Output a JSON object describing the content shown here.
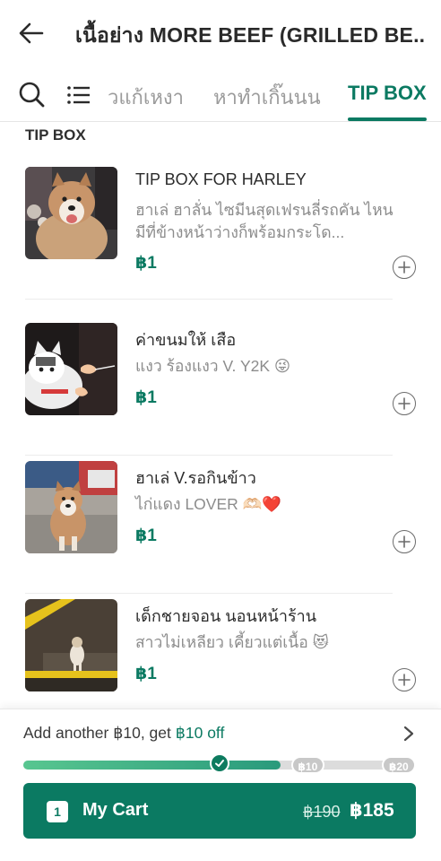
{
  "header": {
    "back_icon": "arrow-left-icon",
    "title": "เนื้อย่าง MORE BEEF (GRILLED BE..."
  },
  "tabbar": {
    "search_icon": "search-icon",
    "menu_icon": "list-menu-icon",
    "tabs": [
      {
        "label": "วแก้เหงา",
        "active": false
      },
      {
        "label": "หาทำเกิ๊นนน",
        "active": false
      },
      {
        "label": "TIP BOX",
        "active": true
      }
    ]
  },
  "section": {
    "title": "TIP BOX"
  },
  "items": [
    {
      "name": "TIP BOX FOR HARLEY",
      "description": "ฮาเล่ ฮาลั่น ไซมีนสุดเฟรนลี่รถคัน ไหนมีที่ข้างหน้าว่างก็พร้อมกระโด...",
      "price": "฿1",
      "thumb": "husky-dog-photo"
    },
    {
      "name": "ค่าขนมให้ เสือ",
      "description": "แงว ร้องแงว V. Y2K 😜",
      "price": "฿1",
      "thumb": "cat-photo"
    },
    {
      "name": "ฮาเล่ V.รอกินข้าว",
      "description": "ไก่แดง LOVER 🫶🏻❤️",
      "price": "฿1",
      "thumb": "husky-waiting-photo"
    },
    {
      "name": "เด็กชายจอน นอนหน้าร้าน",
      "description": "สาวไม่เหลียว เคี้ยวแต่เนื้อ 😻",
      "price": "฿1",
      "thumb": "dog-sleeping-photo"
    }
  ],
  "promo": {
    "text_prefix": "Add another ฿10, get ",
    "text_highlight": "฿10 off",
    "chevron_icon": "chevron-right-icon",
    "progress_fraction": 0.655,
    "milestones": [
      {
        "label": "",
        "reached": true,
        "fraction": 0.5
      },
      {
        "label": "฿10",
        "reached": false,
        "fraction": 0.725
      },
      {
        "label": "฿20",
        "reached": false,
        "fraction": 0.965
      }
    ]
  },
  "cart": {
    "count": "1",
    "label": "My Cart",
    "old_price": "฿190",
    "new_price": "฿185"
  },
  "colors": {
    "brand": "#0b7a62",
    "muted_text": "#8c8c8c"
  }
}
